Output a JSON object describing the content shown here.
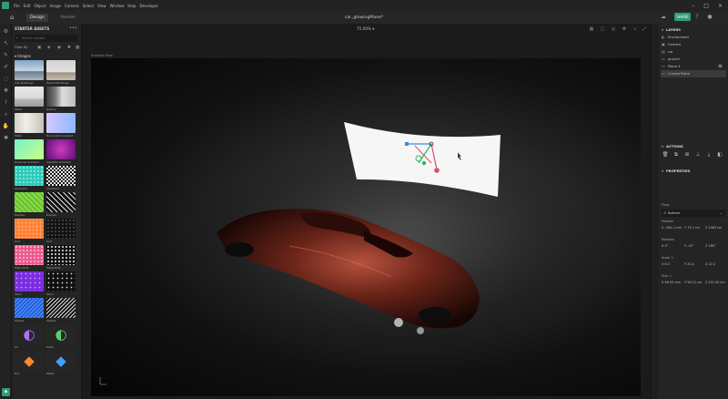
{
  "app": {
    "menu": [
      "File",
      "Edit",
      "Object",
      "Image",
      "Camera",
      "Select",
      "View",
      "Window",
      "Help",
      "Developer"
    ],
    "window_controls": [
      "–",
      "□",
      "×"
    ]
  },
  "header": {
    "tabs": [
      {
        "label": "Design",
        "active": true
      },
      {
        "label": "Render",
        "active": false
      }
    ],
    "document_title": "car_glowingPlane*",
    "share_label": "SHARE"
  },
  "canvas": {
    "zoom_label": "75.00%",
    "artboard_label": "Ambient Haze"
  },
  "assets": {
    "title": "STARTER ASSETS",
    "search_placeholder": "Search Assets",
    "filter_label": "Filter By",
    "section_label": "Images",
    "tiles": [
      {
        "label": "City Buildings",
        "kind": "city"
      },
      {
        "label": "Desert Buildings",
        "kind": "desert"
      },
      {
        "label": "Table",
        "kind": "table"
      },
      {
        "label": "Gallery",
        "kind": "gallery"
      },
      {
        "label": "Table",
        "kind": "room"
      },
      {
        "label": "Horizontal Gradient",
        "kind": "hgrad"
      },
      {
        "label": "Diagonal Gradient",
        "kind": "dgrad"
      },
      {
        "label": "Vignette Gradient",
        "kind": "vgrad"
      },
      {
        "label": "Checkers",
        "kind": "checkers-teal"
      },
      {
        "label": "Checkers",
        "kind": "checkers-white"
      },
      {
        "label": "Dashes",
        "kind": "dashes-green"
      },
      {
        "label": "Dashes",
        "kind": "dashes-white"
      },
      {
        "label": "Grid",
        "kind": "grid-orange"
      },
      {
        "label": "Grid",
        "kind": "grid-white"
      },
      {
        "label": "Polka Dots",
        "kind": "polka-pink"
      },
      {
        "label": "Polka Dots",
        "kind": "polka-white"
      },
      {
        "label": "Stars",
        "kind": "stars-purple"
      },
      {
        "label": "Stars",
        "kind": "stars-white"
      },
      {
        "label": "Stripes",
        "kind": "stripes-blue"
      },
      {
        "label": "Stripes",
        "kind": "stripes-white"
      },
      {
        "label": "Air",
        "kind": "air"
      },
      {
        "label": "Earth",
        "kind": "earth"
      },
      {
        "label": "Fire",
        "kind": "fire"
      },
      {
        "label": "Water",
        "kind": "water"
      }
    ]
  },
  "layers": {
    "title": "LAYERS",
    "items": [
      {
        "label": "Environment",
        "icon": "◐",
        "selected": false
      },
      {
        "label": "Camera",
        "icon": "▣",
        "selected": false
      },
      {
        "label": "car",
        "icon": "▤",
        "selected": false
      },
      {
        "label": "ground",
        "icon": "▭",
        "selected": false
      },
      {
        "label": "Plane 4",
        "icon": "▭",
        "selected": false
      },
      {
        "label": "Curved Plane",
        "icon": "▭",
        "selected": true
      }
    ]
  },
  "actions": {
    "title": "ACTIONS"
  },
  "properties": {
    "title": "PROPERTIES",
    "pivot_label": "Pivot",
    "pivot_value": "Bottom",
    "position_label": "Position",
    "position": {
      "x": "-260.1 mm",
      "y": "75.2 cm",
      "z": "1463 cm"
    },
    "rotation_label": "Rotation",
    "rotation": {
      "x": "3°",
      "y": "-14°",
      "z": "180°"
    },
    "scale_label": "Scale",
    "scale": {
      "x": "6.3",
      "y": "20.4",
      "z": "12.2"
    },
    "size_label": "Size",
    "size": {
      "x": "98.05 mm",
      "y": "56.22 cm",
      "z": "247.40 cm"
    }
  }
}
